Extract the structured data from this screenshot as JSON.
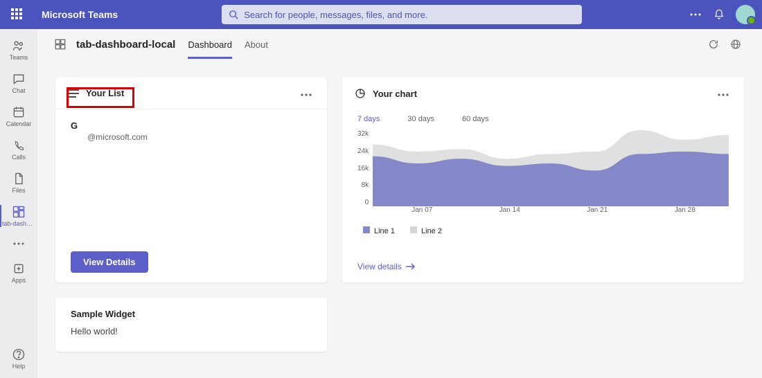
{
  "brand": "Microsoft Teams",
  "search_placeholder": "Search for people, messages, files, and more.",
  "rail": [
    {
      "label": "Teams"
    },
    {
      "label": "Chat"
    },
    {
      "label": "Calendar"
    },
    {
      "label": "Calls"
    },
    {
      "label": "Files"
    },
    {
      "label": "tab-dashbo..."
    },
    {
      "label": "Apps"
    },
    {
      "label": "Help"
    }
  ],
  "app_name": "tab-dashboard-local",
  "tabs": [
    "Dashboard",
    "About"
  ],
  "list_card": {
    "title": "Your List",
    "letter": "G",
    "email": "@microsoft.com",
    "button": "View Details"
  },
  "chart_card": {
    "title": "Your chart",
    "ranges": [
      "7 days",
      "30 days",
      "60 days"
    ],
    "view_link": "View details"
  },
  "chart_data": {
    "type": "area",
    "categories": [
      "Jan 07",
      "Jan 14",
      "Jan 21",
      "Jan 28"
    ],
    "series": [
      {
        "name": "Line 1",
        "color": "#8488c9",
        "values": [
          21000,
          18000,
          20000,
          17000,
          18000,
          15000,
          22000,
          23000,
          22000
        ]
      },
      {
        "name": "Line 2",
        "color": "#d6d6d6",
        "values": [
          26000,
          23000,
          24000,
          20000,
          22000,
          23000,
          32000,
          28000,
          30000
        ]
      }
    ],
    "ylabel": "",
    "xlabel": "",
    "y_ticks": [
      "32k",
      "24k",
      "16k",
      "8k",
      "0"
    ],
    "ylim": [
      0,
      32000
    ]
  },
  "sample_card": {
    "title": "Sample Widget",
    "text": "Hello world!"
  }
}
